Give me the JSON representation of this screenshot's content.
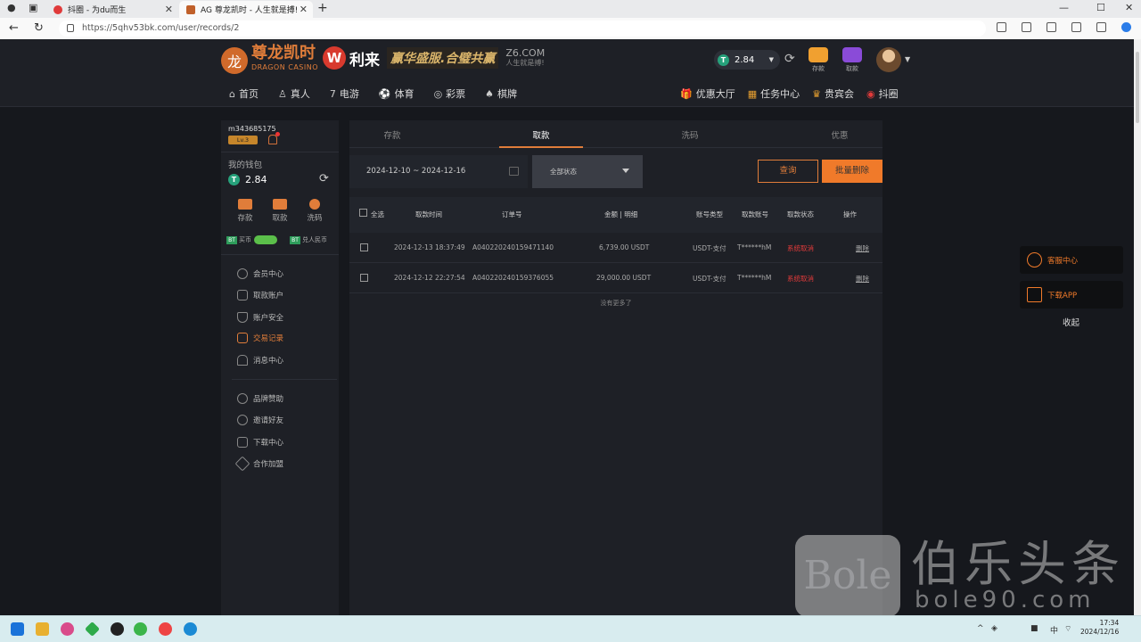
{
  "browser": {
    "tabs": [
      {
        "label": "抖圈 - 为du而生",
        "favicon_color": "#e03a3a"
      },
      {
        "label": "AG 尊龙凯时 - 人生就是搏!",
        "favicon_color": "#c0602a"
      }
    ],
    "new_tab": "+",
    "close": "✕",
    "url": "https://5qhv53bk.com/user/records/2",
    "win_min": "—",
    "win_max": "☐",
    "win_close": "✕"
  },
  "header": {
    "logo_cn": "尊龙凯时",
    "logo_en": "DRAGON CASINO",
    "w_mark": "W",
    "partner": "利来",
    "slogan": "赢华盛服.合璧共赢",
    "z6": "Z6.COM",
    "z6_sub": "人生就是搏!",
    "balance": "2.84",
    "coin": "T",
    "deposit": "存款",
    "withdraw": "取款"
  },
  "mainnav": [
    {
      "icon": "⌂",
      "label": "首页",
      "name": "home"
    },
    {
      "icon": "♙",
      "label": "真人",
      "name": "live"
    },
    {
      "icon": "7",
      "label": "电游",
      "name": "slots"
    },
    {
      "icon": "⚽",
      "label": "体育",
      "name": "sports"
    },
    {
      "icon": "◎",
      "label": "彩票",
      "name": "lottery"
    },
    {
      "icon": "♠",
      "label": "棋牌",
      "name": "cards"
    }
  ],
  "rightnav": [
    {
      "icon": "🎁",
      "label": "优惠大厅",
      "color": "#e35a8a",
      "name": "promo-hall"
    },
    {
      "icon": "▦",
      "label": "任务中心",
      "color": "#e8a030",
      "name": "task-center"
    },
    {
      "icon": "♛",
      "label": "贵宾会",
      "color": "#e8a030",
      "name": "vip"
    },
    {
      "icon": "◉",
      "label": "抖圈",
      "color": "#e03a3a",
      "name": "douquan"
    }
  ],
  "sidebar": {
    "username": "m343685175",
    "level": "Lv.3",
    "wallet_label": "我的钱包",
    "balance": "2.84",
    "actions": [
      "存款",
      "取款",
      "洗码"
    ],
    "crypto_buy": "买币",
    "crypto_rmb": "兑人民币",
    "menu1": [
      "会员中心",
      "取款账户",
      "账户安全",
      "交易记录",
      "消息中心"
    ],
    "menu2": [
      "品牌赞助",
      "邀请好友",
      "下载中心",
      "合作加盟"
    ]
  },
  "content": {
    "tabs": [
      "存款",
      "取款",
      "洗码",
      "优惠"
    ],
    "active_tab": 1,
    "date_range": "2024-12-10 ~ 2024-12-16",
    "status_select": "全部状态",
    "query_btn": "查询",
    "batch_delete_btn": "批量删除",
    "headers": [
      "全选",
      "取款时间",
      "订单号",
      "金额 | 明细",
      "账号类型",
      "取款账号",
      "取款状态",
      "操作"
    ],
    "rows": [
      {
        "time": "2024-12-13 18:37:49",
        "order": "A040220240159471140",
        "amount": "6,739.00 USDT",
        "type": "USDT-支付",
        "account": "T******hM",
        "status": "系统取消",
        "action": "删除"
      },
      {
        "time": "2024-12-12 22:27:54",
        "order": "A040220240159376055",
        "amount": "29,000.00 USDT",
        "type": "USDT-支付",
        "account": "T******hM",
        "status": "系统取消",
        "action": "删除"
      }
    ],
    "no_more": "没有更多了"
  },
  "floating": {
    "service": "客服中心",
    "download": "下载APP",
    "collapse": "收起"
  },
  "watermark": {
    "logo": "Bole",
    "cn": "伯乐头条",
    "domain": "bole90.com"
  },
  "taskbar": {
    "time": "17:34",
    "date": "2024/12/16",
    "lang": "中"
  }
}
